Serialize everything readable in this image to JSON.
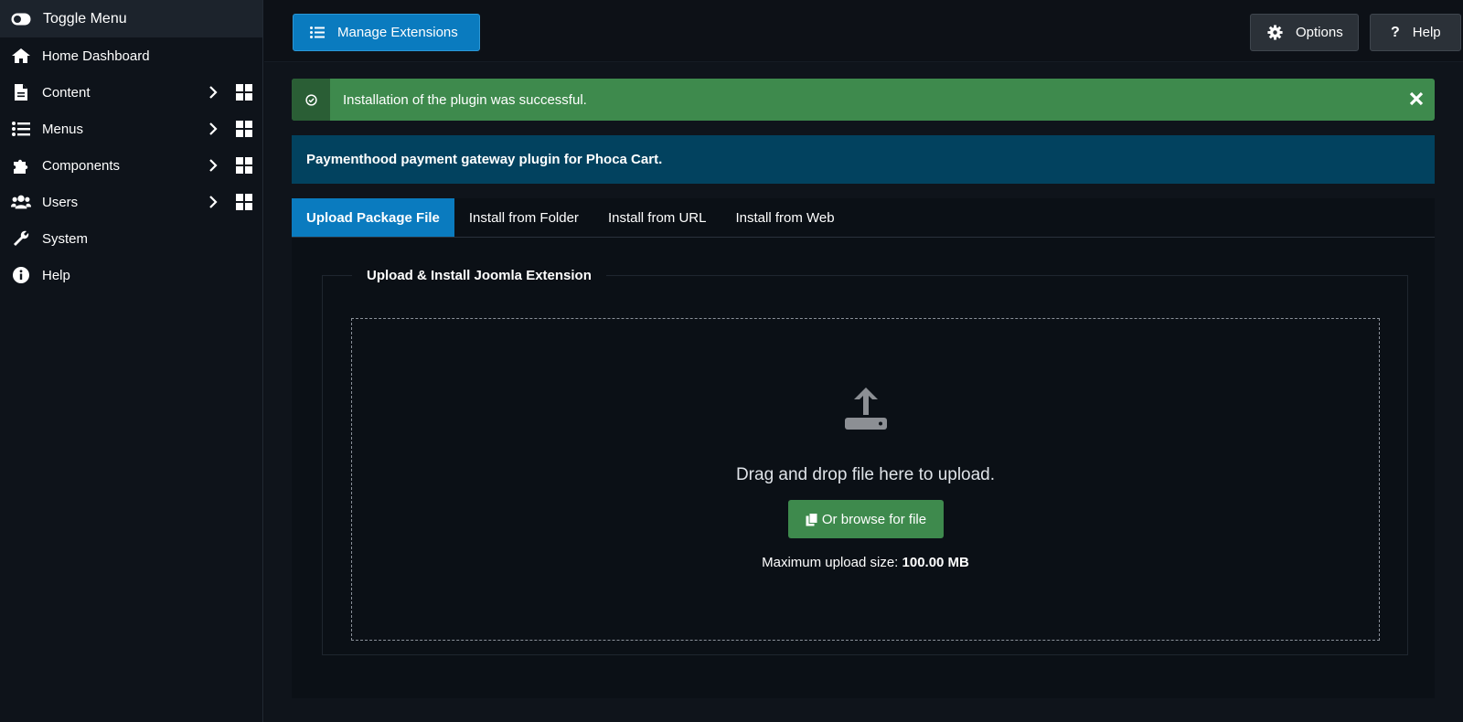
{
  "sidebar": {
    "toggle_label": "Toggle Menu",
    "items": [
      {
        "label": "Home Dashboard"
      },
      {
        "label": "Content"
      },
      {
        "label": "Menus"
      },
      {
        "label": "Components"
      },
      {
        "label": "Users"
      },
      {
        "label": "System"
      },
      {
        "label": "Help"
      }
    ]
  },
  "toolbar": {
    "manage_label": "Manage Extensions",
    "options_label": "Options",
    "help_label": "Help"
  },
  "alert": {
    "message": "Installation of the plugin was successful."
  },
  "info": {
    "text": "Paymenthood payment gateway plugin for Phoca Cart."
  },
  "tabs": [
    {
      "label": "Upload Package File",
      "active": true
    },
    {
      "label": "Install from Folder"
    },
    {
      "label": "Install from URL"
    },
    {
      "label": "Install from Web"
    }
  ],
  "upload": {
    "legend": "Upload & Install Joomla Extension",
    "drag_text": "Drag and drop file here to upload.",
    "browse_label": "Or browse for file",
    "max_label": "Maximum upload size:",
    "max_value": "100.00 MB"
  },
  "colors": {
    "primary": "#0a7bbf",
    "success": "#3e8a4d",
    "info": "#02425f",
    "background": "#0d1117"
  }
}
